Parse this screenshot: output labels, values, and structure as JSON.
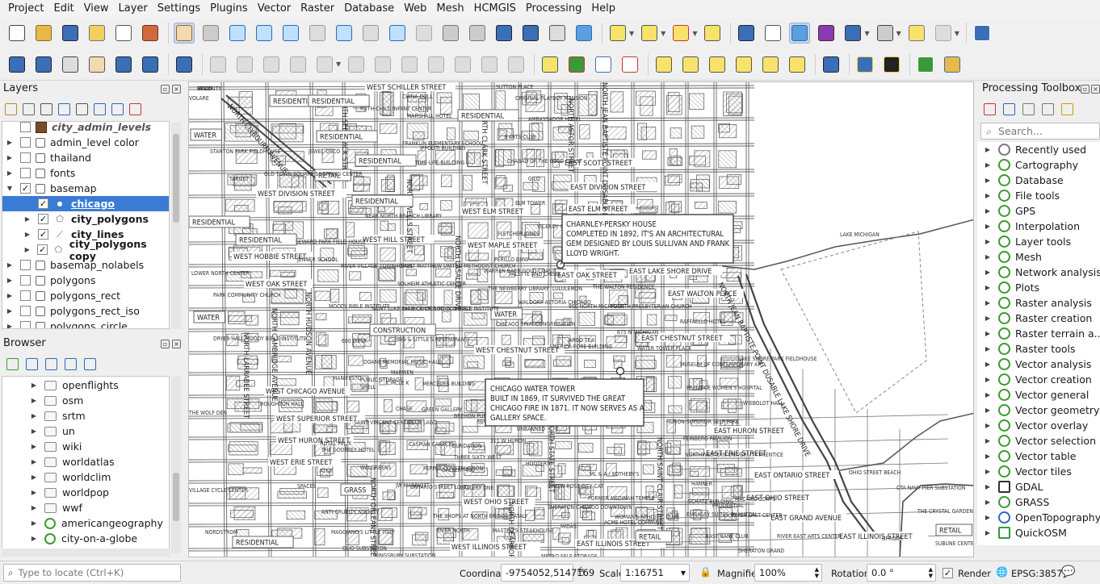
{
  "menu": [
    "Project",
    "Edit",
    "View",
    "Layer",
    "Settings",
    "Plugins",
    "Vector",
    "Raster",
    "Database",
    "Web",
    "Mesh",
    "HCMGIS",
    "Processing",
    "Help"
  ],
  "layers_panel": {
    "title": "Layers",
    "items": [
      {
        "label": "city_admin_levels",
        "checked": false,
        "italic": true,
        "bold": false
      },
      {
        "label": "admin_level color",
        "checked": false
      },
      {
        "label": "thailand",
        "checked": false
      },
      {
        "label": "fonts",
        "checked": false
      },
      {
        "label": "basemap",
        "checked": true
      },
      {
        "label": "chicago",
        "checked": true,
        "selected": true
      },
      {
        "label": "city_polygons",
        "checked": true,
        "bold": true
      },
      {
        "label": "city_lines",
        "checked": true,
        "bold": true
      },
      {
        "label": "city_polygons copy",
        "checked": true,
        "bold": true
      },
      {
        "label": "basemap_nolabels",
        "checked": false
      },
      {
        "label": "polygons",
        "checked": false
      },
      {
        "label": "polygons_rect",
        "checked": false
      },
      {
        "label": "polygons_rect_iso",
        "checked": false
      },
      {
        "label": "polygons_circle",
        "checked": false
      }
    ]
  },
  "browser_panel": {
    "title": "Browser",
    "items": [
      "openflights",
      "osm",
      "srtm",
      "un",
      "wiki",
      "worldatlas",
      "worldclim",
      "worldpop",
      "wwf",
      "americangeography",
      "city-on-a-globe"
    ]
  },
  "toolbox": {
    "title": "Processing Toolbox",
    "search_placeholder": "Search...",
    "items": [
      "Recently used",
      "Cartography",
      "Database",
      "File tools",
      "GPS",
      "Interpolation",
      "Layer tools",
      "Mesh",
      "Network analysis",
      "Plots",
      "Raster analysis",
      "Raster creation",
      "Raster terrain a...",
      "Raster tools",
      "Vector analysis",
      "Vector creation",
      "Vector general",
      "Vector geometry",
      "Vector overlay",
      "Vector selection",
      "Vector table",
      "Vector tiles",
      "GDAL",
      "GRASS",
      "OpenTopography",
      "QuickOSM"
    ]
  },
  "map": {
    "callouts": {
      "charnley": [
        "CHARNLEY-PERSKY HOUSE",
        "COMPLETED IN 1892, IT'S AN ARCHITECTURAL",
        "GEM DESIGNED BY LOUIS SULLIVAN AND FRANK",
        "LLOYD WRIGHT."
      ],
      "tower": [
        "CHICAGO WATER TOWER",
        "BUILT IN 1869, IT SURVIVED THE GREAT",
        "CHICAGO FIRE IN 1871. IT NOW SERVES AS A",
        "GALLERY SPACE."
      ]
    },
    "street_labels_h": [
      {
        "t": "WEST SCHILLER STREET"
      },
      {
        "t": "EAST SCOTT STREET"
      },
      {
        "t": "WEST DIVISION STREET"
      },
      {
        "t": "EAST DIVISION STREET"
      },
      {
        "t": "WEST ELM STREET"
      },
      {
        "t": "EAST ELM STREET"
      },
      {
        "t": "WEST HILL STREET"
      },
      {
        "t": "WEST MAPLE STREET"
      },
      {
        "t": "WEST HOBBIE STREET"
      },
      {
        "t": "WEST OAK STREET"
      },
      {
        "t": "EAST OAK STREET"
      },
      {
        "t": "EAST LAKE SHORE DRIVE"
      },
      {
        "t": "EAST WALTON PLACE"
      },
      {
        "t": "EAST CHESTNUT STREET"
      },
      {
        "t": "WEST CHESTNUT STREET"
      },
      {
        "t": "WEST CHICAGO AVENUE"
      },
      {
        "t": "WEST SUPERIOR STREET"
      },
      {
        "t": "WEST HURON STREET"
      },
      {
        "t": "EAST HURON STREET"
      },
      {
        "t": "WEST ERIE STREET"
      },
      {
        "t": "EAST ERIE STREET"
      },
      {
        "t": "EAST ONTARIO STREET"
      },
      {
        "t": "WEST OHIO STREET"
      },
      {
        "t": "EAST OHIO STREET"
      },
      {
        "t": "EAST GRAND AVENUE"
      },
      {
        "t": "EAST ILLINOIS STREET"
      },
      {
        "t": "WEST ILLINOIS STREET"
      },
      {
        "t": "EAST ILLINOIS STREET"
      }
    ],
    "street_labels_v": [
      {
        "t": "NORTH CLYBOURN AVENUE"
      },
      {
        "t": "NORTH SEDGWICK STREET"
      },
      {
        "t": "NORTH WELLS STREET"
      },
      {
        "t": "NORTH CLARK STREET"
      },
      {
        "t": "NORTH ASTOR STREET"
      },
      {
        "t": "NORTH JEAN BAPTISTE POINT DUSABLE LAKE"
      },
      {
        "t": "NORTH LASALLE DRIVE"
      },
      {
        "t": "NORTH HUDSON AVENUE"
      },
      {
        "t": "NORTH CAMBRIDGE AVENUE"
      },
      {
        "t": "NORTH LARRABEE STREET"
      },
      {
        "t": "NORTH STATE STREET"
      },
      {
        "t": "NORTH SAINT CLAIR STREET"
      },
      {
        "t": "NORTH ORLEANS STREET"
      },
      {
        "t": "NORTH DEARBORN STREET"
      },
      {
        "t": "NORTH JEAN BAPTISTE POINT DUSABLE LAKE SHORE DRIVE"
      }
    ],
    "boxed_labels": [
      "RESIDENTIAL",
      "RESIDENTIAL",
      "RESIDENTIAL",
      "RESIDENTIAL",
      "RESIDENTIAL",
      "RESIDENTIAL",
      "RESIDENTIAL",
      "RESIDENTIAL",
      "RESIDENTIAL",
      "WATER",
      "WATER",
      "WATER",
      "RETAIL",
      "RETAIL",
      "RETAIL",
      "CONSTRUCTION",
      "GRASS"
    ],
    "poi_labels": [
      {
        "t": "SUTTON PLACE"
      },
      {
        "t": "ORIGINAL PLAYBOY MANSION"
      },
      {
        "t": "AMBASSADOR HOTEL"
      },
      {
        "t": "3 ARTS CLUB"
      },
      {
        "t": "CHABAD OF THE GOLD COAST"
      },
      {
        "t": "GILD"
      },
      {
        "t": "ELM TOWER"
      },
      {
        "t": "VICEROY CHICAGO"
      },
      {
        "t": "FLETCHER JONES"
      },
      {
        "t": "PERILLO BMW"
      },
      {
        "t": "WARREN BARR GOLD COAST"
      },
      {
        "t": "PALETTE AND CHISEL"
      },
      {
        "t": "THE NEWBERRY LIBRARY"
      },
      {
        "t": "LULULEMON"
      },
      {
        "t": "THE WALTON RESIDENCE"
      },
      {
        "t": "WALDORF ASTORIA CHICAGO"
      },
      {
        "t": "FOURTH PRESBYTERIAN CHURCH"
      },
      {
        "t": "900 NORTH MICHIGAN"
      },
      {
        "t": "CHICAGO SINAI CONGREGATION"
      },
      {
        "t": "875 N MICHIGAN"
      },
      {
        "t": "RAFFAELLO HOTEL"
      },
      {
        "t": "ARGO TEA"
      },
      {
        "t": "AMERICA-FORE BUILDING"
      },
      {
        "t": "WATER TOWER PLACE"
      },
      {
        "t": "LAKE SHORE PARK FIELDHOUSE"
      },
      {
        "t": "MUSEUM OF CONTEMPORARY ART"
      },
      {
        "t": "PRENTICE WOMEN'S HOSPITAL"
      },
      {
        "t": "WIEBOLDT HALL"
      },
      {
        "t": "HURON-SUPERIOR SELF PARK"
      },
      {
        "t": "FEINBERG PAVILION"
      },
      {
        "t": "NORTHWESTERN UNIVERSITY PRENTICE"
      },
      {
        "t": "OHIO STREET BEACH"
      },
      {
        "t": "CTA NAVY PIER SUBSTATION"
      },
      {
        "t": "THE CRYSTAL GARDENS"
      },
      {
        "t": "RIVER EAST CENTER"
      },
      {
        "t": "RIVER EAST ARTS CENTER"
      },
      {
        "t": "SHERATON GRAND"
      },
      {
        "t": "LAKE MICHIGAN"
      },
      {
        "t": "STANTON PARK FIELDHOUSE"
      },
      {
        "t": "JEWEL-OSCO"
      },
      {
        "t": "TARGET"
      },
      {
        "t": "OLD TOWN SQUARE SHOPPING CENTER"
      },
      {
        "t": "NEAR NORTH BRANCH LIBRARY"
      },
      {
        "t": "SEWARD PARK FIELD HOUSE"
      },
      {
        "t": "JENNER SCHOOL"
      },
      {
        "t": "LOWER NORTH CENTER"
      },
      {
        "t": "PARK COMMUNITY CHURCH"
      },
      {
        "t": "RIVER VILLAGE TOWNHOMES"
      },
      {
        "t": "SAINT MATTHEW UNITED METHODIST CHURCH"
      },
      {
        "t": "SOLHEIM ATHLETIC CENTER"
      },
      {
        "t": "MOODY BIBLE INSTITUTE"
      },
      {
        "t": "SAINT LUKE CHURCH OF GOD IN CHRIST"
      },
      {
        "t": "MAIL CENTER MOODY BIBLE INSTITUTE"
      },
      {
        "t": "DRYER HALL MOODY BIBLE INSTITUTE"
      },
      {
        "t": "600 WEST"
      },
      {
        "t": "BIG & LITTLE'S RESTAURANT"
      },
      {
        "t": "DOANE MEMORIAL MUSIC HALL"
      },
      {
        "t": "MARWEN"
      },
      {
        "t": "MANIFESTO"
      },
      {
        "t": "PUBLIC STORAGE"
      },
      {
        "t": "SHELL"
      },
      {
        "t": "CIRCLE K"
      },
      {
        "t": "MERCEDES BUILDING"
      },
      {
        "t": "HOUGHTON HALL"
      },
      {
        "t": "CHASE"
      },
      {
        "t": "GREEN GALLERY"
      },
      {
        "t": "BREHON PUB"
      },
      {
        "t": "SAINT VINCENT CENTER"
      },
      {
        "t": "CLUB LAGO"
      },
      {
        "t": "SEVEN"
      },
      {
        "t": "UNBANNED"
      },
      {
        "t": "CASPIAN CARPETS"
      },
      {
        "t": "FOUNDATION"
      },
      {
        "t": "311 W HURON"
      },
      {
        "t": "THE GODFREY HOTEL"
      },
      {
        "t": "HOTEL FELIX"
      },
      {
        "t": "THREE SIXTY WEST"
      },
      {
        "t": "HOOTERS"
      },
      {
        "t": "WALGREENS"
      },
      {
        "t": "AT&T"
      },
      {
        "t": "PEPPER CONSTRUCTION"
      },
      {
        "t": "GALLERY 400"
      },
      {
        "t": "GALLERY ONE"
      },
      {
        "t": "SPACES"
      },
      {
        "t": "JW MARRIOTT"
      },
      {
        "t": "ONTARIO STREET LOFTS"
      },
      {
        "t": "GREEN ROSE CITY CAT"
      },
      {
        "t": "ML & A / SOTHEBY'S"
      },
      {
        "t": "FORMER MEDINAH TEMPLE"
      },
      {
        "t": "WOMAN'S ATHLETIC CLUB"
      },
      {
        "t": "SHERATON CHICAGO DOWNTOWN"
      },
      {
        "t": "GAP"
      },
      {
        "t": "ACME HOTEL COMPANY"
      },
      {
        "t": "EATALY"
      },
      {
        "t": "THE SHOPS AT NORTH BRIDGE"
      },
      {
        "t": "RIVER NORTH"
      },
      {
        "t": "MASTRO'S STEAKHOUSE"
      },
      {
        "t": "MIDAS"
      },
      {
        "t": "ANTI-CRUELTY SOCIETY"
      },
      {
        "t": "MAGGIANO'S LITTLE ITALY"
      },
      {
        "t": "NORDSTROM"
      },
      {
        "t": "OLIO SUBSTATION"
      },
      {
        "t": "KINGSBURY SUBSTATION"
      },
      {
        "t": "METRO SELF STORAGE"
      },
      {
        "t": "EAST BANK CLUB"
      },
      {
        "t": "HANNER"
      },
      {
        "t": "MACANO CORPS"
      },
      {
        "t": "EMBASSY SUITES BY HILTON"
      },
      {
        "t": "SCHATZ BUILDING"
      },
      {
        "t": "PRUDENTIAL"
      },
      {
        "t": "VOLARE"
      },
      {
        "t": "IPPOLITI BUILDING"
      },
      {
        "t": "TIME-LIFE BUILDING"
      },
      {
        "t": "RUTH-CHILD INFANT CENTER"
      },
      {
        "t": "CHINA DOLL"
      },
      {
        "t": "MARSHALL HOTEL"
      },
      {
        "t": "FRANKLIN ELEMENTARY SCHOOL"
      },
      {
        "t": "THE WOLF DEN"
      },
      {
        "t": "VILLAGE CYCLE CENTER"
      },
      {
        "t": "UPROAR"
      },
      {
        "t": "SUBUNE CENTER"
      },
      {
        "t": "ET CO."
      },
      {
        "t": "HYATT"
      },
      {
        "t": "SECURITY"
      }
    ]
  },
  "statusbar": {
    "locate_placeholder": "Type to locate (Ctrl+K)",
    "coordinate_label": "Coordinate",
    "coordinate_value": "-9754052,5147169",
    "scale_label": "Scale",
    "scale_value": "1:16751",
    "magnifier_label": "Magnifier",
    "magnifier_value": "100%",
    "rotation_label": "Rotation",
    "rotation_value": "0.0 °",
    "render_label": "Render",
    "crs": "EPSG:3857"
  }
}
